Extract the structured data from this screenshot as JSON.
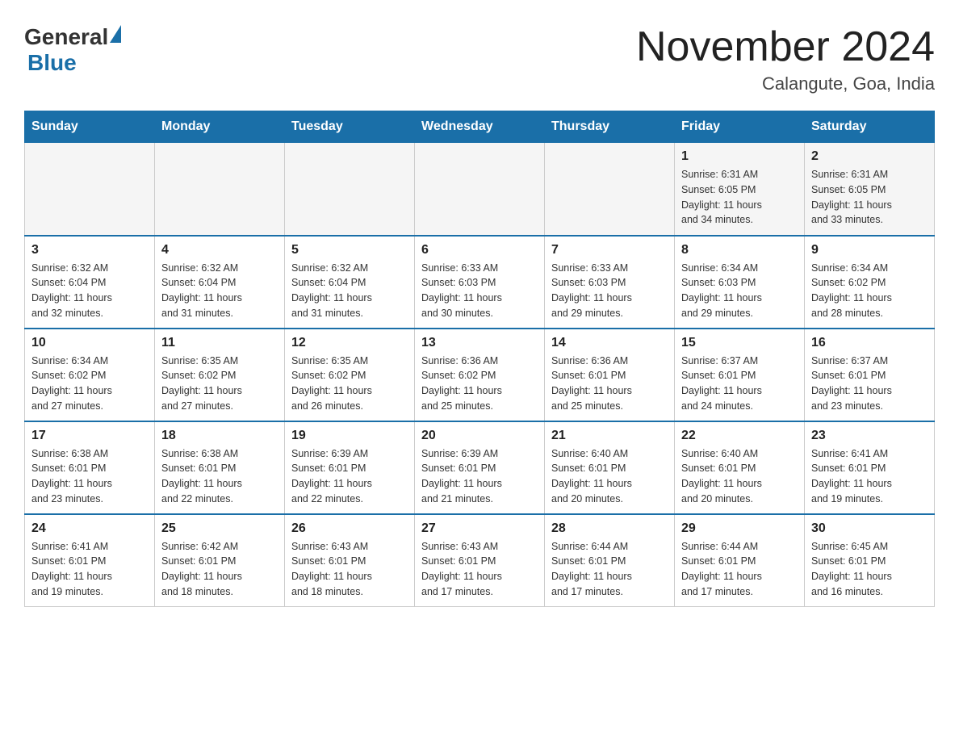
{
  "logo": {
    "general": "General",
    "blue": "Blue"
  },
  "title": "November 2024",
  "location": "Calangute, Goa, India",
  "days_of_week": [
    "Sunday",
    "Monday",
    "Tuesday",
    "Wednesday",
    "Thursday",
    "Friday",
    "Saturday"
  ],
  "weeks": [
    [
      {
        "day": "",
        "info": ""
      },
      {
        "day": "",
        "info": ""
      },
      {
        "day": "",
        "info": ""
      },
      {
        "day": "",
        "info": ""
      },
      {
        "day": "",
        "info": ""
      },
      {
        "day": "1",
        "info": "Sunrise: 6:31 AM\nSunset: 6:05 PM\nDaylight: 11 hours\nand 34 minutes."
      },
      {
        "day": "2",
        "info": "Sunrise: 6:31 AM\nSunset: 6:05 PM\nDaylight: 11 hours\nand 33 minutes."
      }
    ],
    [
      {
        "day": "3",
        "info": "Sunrise: 6:32 AM\nSunset: 6:04 PM\nDaylight: 11 hours\nand 32 minutes."
      },
      {
        "day": "4",
        "info": "Sunrise: 6:32 AM\nSunset: 6:04 PM\nDaylight: 11 hours\nand 31 minutes."
      },
      {
        "day": "5",
        "info": "Sunrise: 6:32 AM\nSunset: 6:04 PM\nDaylight: 11 hours\nand 31 minutes."
      },
      {
        "day": "6",
        "info": "Sunrise: 6:33 AM\nSunset: 6:03 PM\nDaylight: 11 hours\nand 30 minutes."
      },
      {
        "day": "7",
        "info": "Sunrise: 6:33 AM\nSunset: 6:03 PM\nDaylight: 11 hours\nand 29 minutes."
      },
      {
        "day": "8",
        "info": "Sunrise: 6:34 AM\nSunset: 6:03 PM\nDaylight: 11 hours\nand 29 minutes."
      },
      {
        "day": "9",
        "info": "Sunrise: 6:34 AM\nSunset: 6:02 PM\nDaylight: 11 hours\nand 28 minutes."
      }
    ],
    [
      {
        "day": "10",
        "info": "Sunrise: 6:34 AM\nSunset: 6:02 PM\nDaylight: 11 hours\nand 27 minutes."
      },
      {
        "day": "11",
        "info": "Sunrise: 6:35 AM\nSunset: 6:02 PM\nDaylight: 11 hours\nand 27 minutes."
      },
      {
        "day": "12",
        "info": "Sunrise: 6:35 AM\nSunset: 6:02 PM\nDaylight: 11 hours\nand 26 minutes."
      },
      {
        "day": "13",
        "info": "Sunrise: 6:36 AM\nSunset: 6:02 PM\nDaylight: 11 hours\nand 25 minutes."
      },
      {
        "day": "14",
        "info": "Sunrise: 6:36 AM\nSunset: 6:01 PM\nDaylight: 11 hours\nand 25 minutes."
      },
      {
        "day": "15",
        "info": "Sunrise: 6:37 AM\nSunset: 6:01 PM\nDaylight: 11 hours\nand 24 minutes."
      },
      {
        "day": "16",
        "info": "Sunrise: 6:37 AM\nSunset: 6:01 PM\nDaylight: 11 hours\nand 23 minutes."
      }
    ],
    [
      {
        "day": "17",
        "info": "Sunrise: 6:38 AM\nSunset: 6:01 PM\nDaylight: 11 hours\nand 23 minutes."
      },
      {
        "day": "18",
        "info": "Sunrise: 6:38 AM\nSunset: 6:01 PM\nDaylight: 11 hours\nand 22 minutes."
      },
      {
        "day": "19",
        "info": "Sunrise: 6:39 AM\nSunset: 6:01 PM\nDaylight: 11 hours\nand 22 minutes."
      },
      {
        "day": "20",
        "info": "Sunrise: 6:39 AM\nSunset: 6:01 PM\nDaylight: 11 hours\nand 21 minutes."
      },
      {
        "day": "21",
        "info": "Sunrise: 6:40 AM\nSunset: 6:01 PM\nDaylight: 11 hours\nand 20 minutes."
      },
      {
        "day": "22",
        "info": "Sunrise: 6:40 AM\nSunset: 6:01 PM\nDaylight: 11 hours\nand 20 minutes."
      },
      {
        "day": "23",
        "info": "Sunrise: 6:41 AM\nSunset: 6:01 PM\nDaylight: 11 hours\nand 19 minutes."
      }
    ],
    [
      {
        "day": "24",
        "info": "Sunrise: 6:41 AM\nSunset: 6:01 PM\nDaylight: 11 hours\nand 19 minutes."
      },
      {
        "day": "25",
        "info": "Sunrise: 6:42 AM\nSunset: 6:01 PM\nDaylight: 11 hours\nand 18 minutes."
      },
      {
        "day": "26",
        "info": "Sunrise: 6:43 AM\nSunset: 6:01 PM\nDaylight: 11 hours\nand 18 minutes."
      },
      {
        "day": "27",
        "info": "Sunrise: 6:43 AM\nSunset: 6:01 PM\nDaylight: 11 hours\nand 17 minutes."
      },
      {
        "day": "28",
        "info": "Sunrise: 6:44 AM\nSunset: 6:01 PM\nDaylight: 11 hours\nand 17 minutes."
      },
      {
        "day": "29",
        "info": "Sunrise: 6:44 AM\nSunset: 6:01 PM\nDaylight: 11 hours\nand 17 minutes."
      },
      {
        "day": "30",
        "info": "Sunrise: 6:45 AM\nSunset: 6:01 PM\nDaylight: 11 hours\nand 16 minutes."
      }
    ]
  ]
}
